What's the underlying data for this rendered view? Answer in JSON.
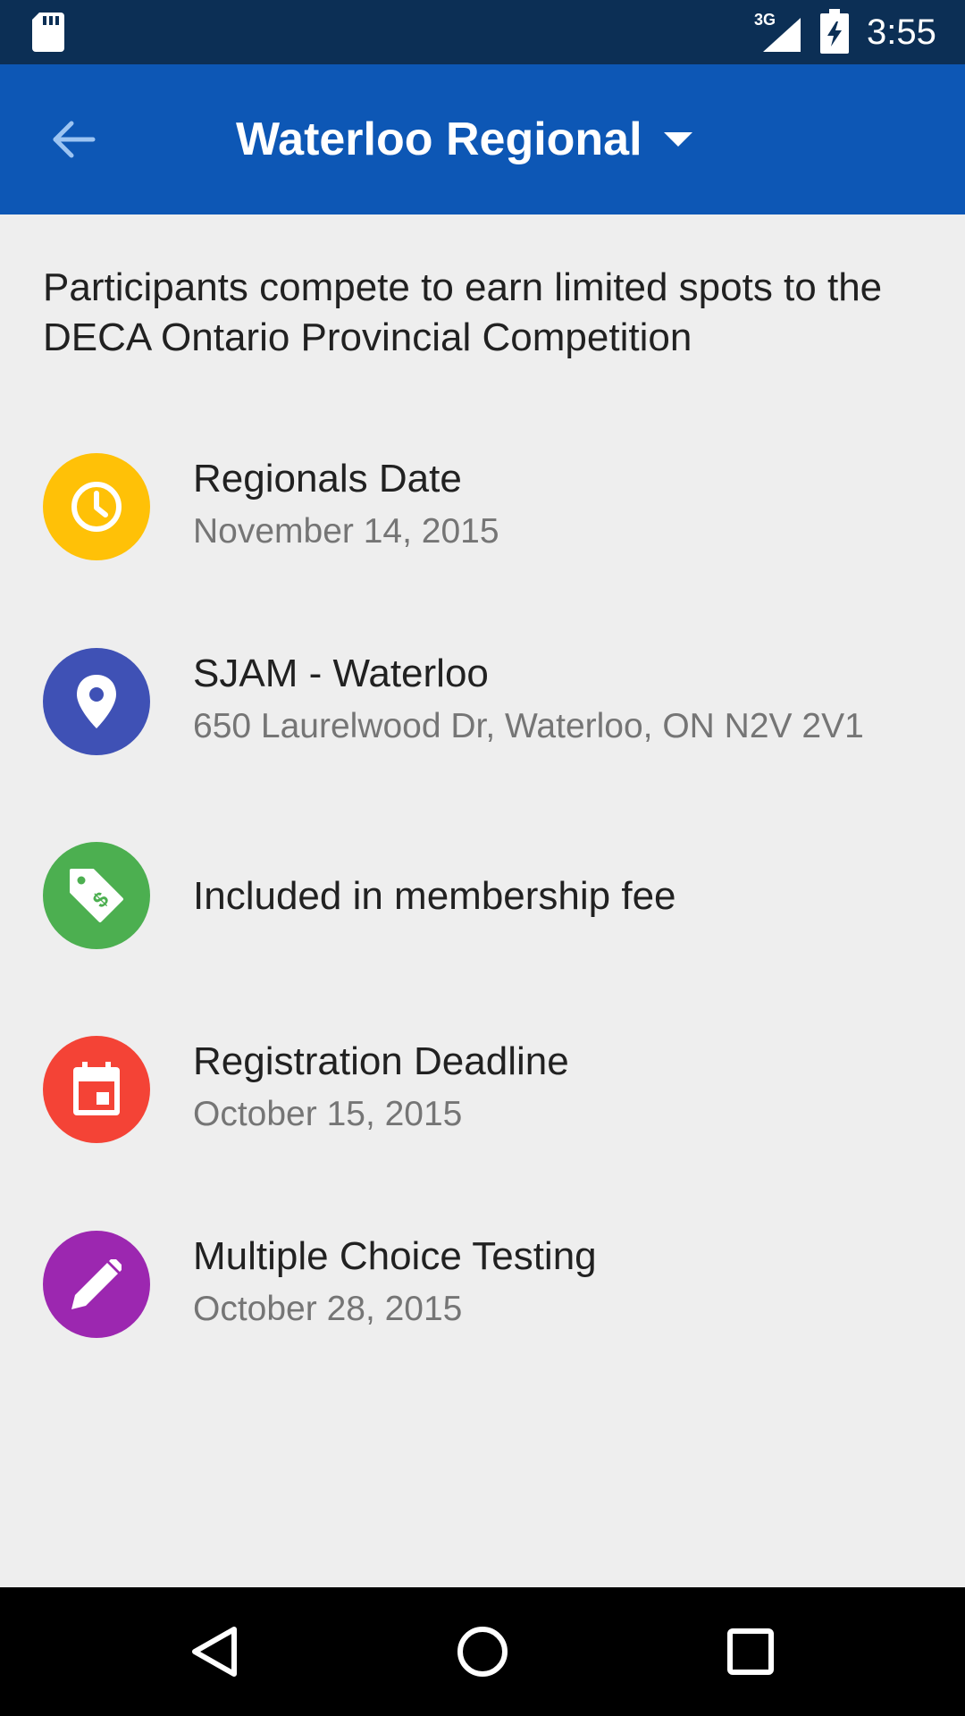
{
  "status_bar": {
    "network": "3G",
    "time": "3:55",
    "icons": [
      "sd-card-icon",
      "signal-icon",
      "battery-charging-icon"
    ]
  },
  "app_bar": {
    "title": "Waterloo Regional",
    "back_icon": "arrow-back-icon",
    "dropdown_icon": "dropdown-arrow-icon",
    "background_color": "#0d57b5"
  },
  "description": "Participants compete to earn limited spots to the DECA Ontario Provincial Competition",
  "info_items": [
    {
      "icon": "clock-icon",
      "color": "#ffc107",
      "primary": "Regionals Date",
      "secondary": "November 14, 2015"
    },
    {
      "icon": "location-pin-icon",
      "color": "#3f51b5",
      "primary": "SJAM - Waterloo",
      "secondary": "650 Laurelwood Dr, Waterloo, ON N2V 2V1"
    },
    {
      "icon": "price-tag-icon",
      "color": "#4caf50",
      "primary": "Included in membership fee",
      "secondary": ""
    },
    {
      "icon": "calendar-icon",
      "color": "#f44336",
      "primary": "Registration Deadline",
      "secondary": "October 15, 2015"
    },
    {
      "icon": "pencil-icon",
      "color": "#9c27b0",
      "primary": "Multiple Choice Testing",
      "secondary": "October 28, 2015"
    }
  ],
  "nav_bar": {
    "buttons": [
      "back-triangle-icon",
      "home-circle-icon",
      "recents-square-icon"
    ]
  }
}
